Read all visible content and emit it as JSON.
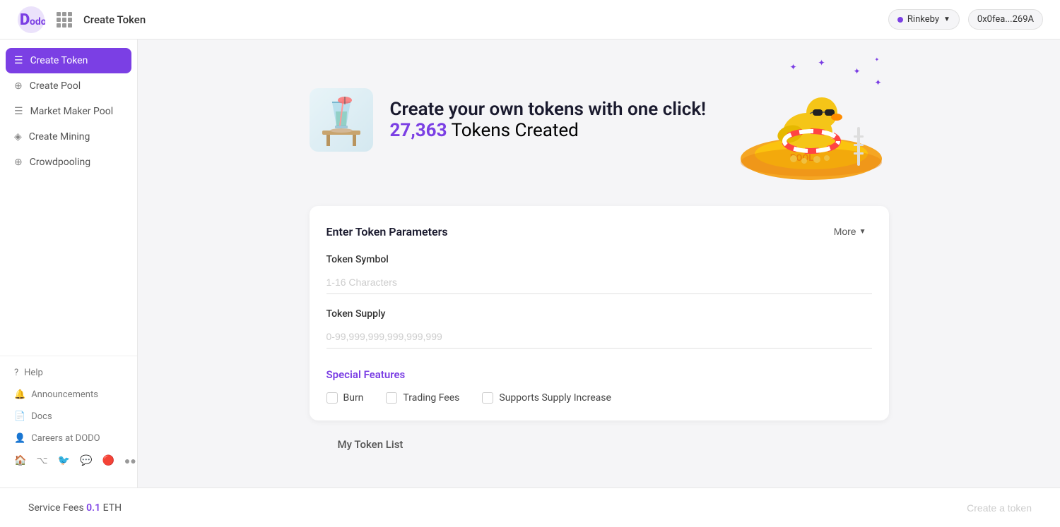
{
  "header": {
    "title": "Create Token",
    "network": "Rinkeby",
    "wallet": "0x0fea...269A"
  },
  "sidebar": {
    "items": [
      {
        "id": "create-token",
        "label": "Create Token",
        "icon": "☰",
        "active": true
      },
      {
        "id": "create-pool",
        "label": "Create Pool",
        "icon": "⊕",
        "active": false
      },
      {
        "id": "market-maker-pool",
        "label": "Market Maker Pool",
        "icon": "☰",
        "active": false
      },
      {
        "id": "create-mining",
        "label": "Create Mining",
        "icon": "◈",
        "active": false
      },
      {
        "id": "crowdpooling",
        "label": "Crowdpooling",
        "icon": "⊕",
        "active": false
      }
    ],
    "bottom": [
      {
        "id": "help",
        "label": "Help",
        "icon": "?"
      },
      {
        "id": "announcements",
        "label": "Announcements",
        "icon": "🔔"
      },
      {
        "id": "docs",
        "label": "Docs",
        "icon": "📄"
      },
      {
        "id": "careers",
        "label": "Careers at DODO",
        "icon": "👤"
      }
    ]
  },
  "hero": {
    "headline": "Create your own tokens with one click!",
    "token_count": "27,363",
    "tokens_created_label": "Tokens Created"
  },
  "form": {
    "section_title": "Enter Token Parameters",
    "more_label": "More",
    "token_symbol_label": "Token Symbol",
    "token_symbol_placeholder": "1-16 Characters",
    "token_supply_label": "Token Supply",
    "token_supply_placeholder": "0-99,999,999,999,999,999",
    "special_features_title": "Special Features",
    "checkboxes": [
      {
        "id": "burn",
        "label": "Burn"
      },
      {
        "id": "trading-fees",
        "label": "Trading Fees"
      },
      {
        "id": "supply-increase",
        "label": "Supports Supply Increase"
      }
    ]
  },
  "footer": {
    "service_fees_label": "Service Fees",
    "fee_amount": "0.1",
    "fee_currency": "ETH",
    "create_button_label": "Create a token"
  },
  "token_list": {
    "title": "My Token List"
  }
}
